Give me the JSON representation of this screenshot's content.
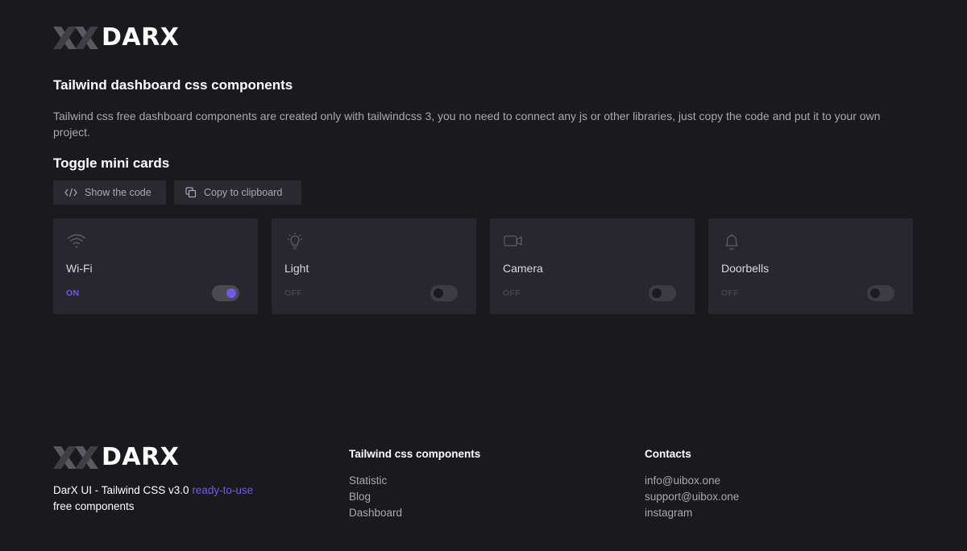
{
  "brand": {
    "name": "DARX"
  },
  "header": {
    "title": "Tailwind dashboard css components",
    "description": "Tailwind css free dashboard components are created only with tailwindcss 3, you no need to connect any js or other libraries, just copy the code and put it to your own project."
  },
  "section": {
    "title": "Toggle mini cards",
    "show_code_label": "Show the code",
    "copy_label": "Copy to clipboard"
  },
  "cards": [
    {
      "name": "Wi-Fi",
      "state": "ON",
      "on": true,
      "icon": "wifi-icon"
    },
    {
      "name": "Light",
      "state": "OFF",
      "on": false,
      "icon": "lightbulb-icon"
    },
    {
      "name": "Camera",
      "state": "OFF",
      "on": false,
      "icon": "video-camera-icon"
    },
    {
      "name": "Doorbells",
      "state": "OFF",
      "on": false,
      "icon": "bell-icon"
    }
  ],
  "footer": {
    "tagline_prefix": "DarX UI - Tailwind CSS v3.0 ",
    "tagline_accent": "ready-to-use",
    "tagline_suffix": "free components",
    "components_title": "Tailwind css components",
    "components_links": [
      "Statistic",
      "Blog",
      "Dashboard"
    ],
    "contacts_title": "Contacts",
    "contacts_links": [
      "info@uibox.one",
      "support@uibox.one",
      "instagram"
    ]
  },
  "colors": {
    "background": "#1a191e",
    "card": "#28272d",
    "accent": "#6c5ce7"
  }
}
